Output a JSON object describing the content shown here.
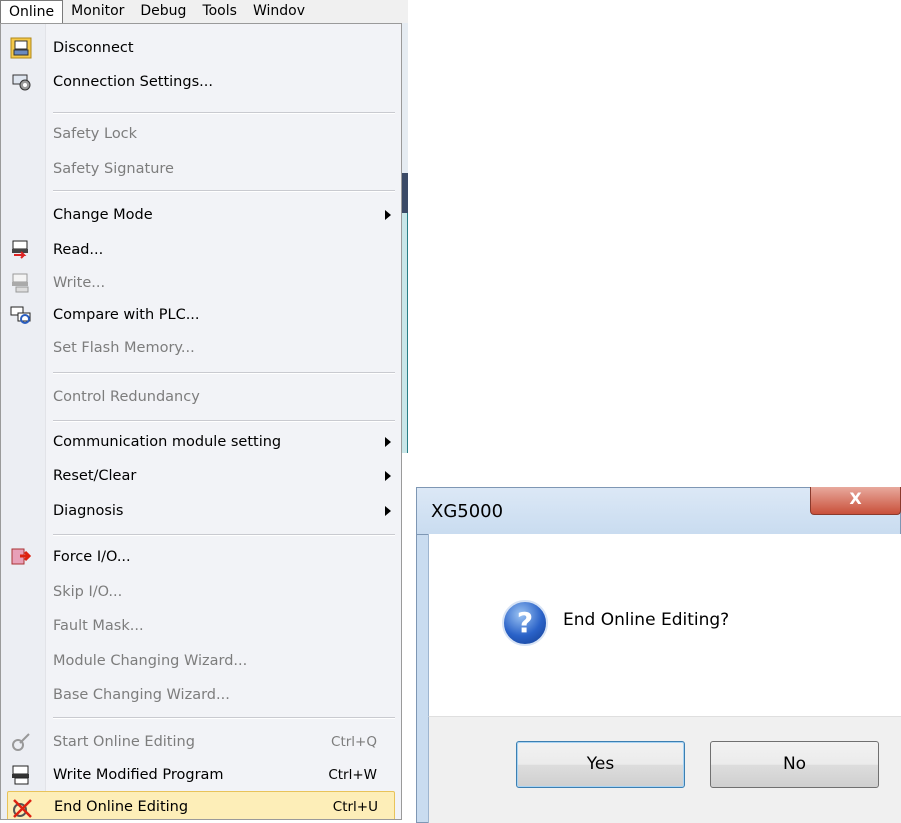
{
  "menubar": {
    "items": [
      "Online",
      "Monitor",
      "Debug",
      "Tools",
      "Windov"
    ]
  },
  "menu": {
    "items": [
      {
        "label": "Disconnect",
        "icon": "disconnect-icon",
        "enabled": true
      },
      {
        "label": "Connection Settings...",
        "icon": "connection-settings-icon",
        "enabled": true
      },
      {
        "label": "Safety Lock",
        "enabled": false
      },
      {
        "label": "Safety Signature",
        "enabled": false
      },
      {
        "label": "Change Mode",
        "enabled": true,
        "submenu": true
      },
      {
        "label": "Read...",
        "icon": "read-icon",
        "enabled": true
      },
      {
        "label": "Write...",
        "icon": "write-icon",
        "enabled": false
      },
      {
        "label": "Compare with PLC...",
        "icon": "compare-icon",
        "enabled": true
      },
      {
        "label": "Set Flash Memory...",
        "enabled": false
      },
      {
        "label": "Control Redundancy",
        "enabled": false
      },
      {
        "label": "Communication module setting",
        "enabled": true,
        "submenu": true
      },
      {
        "label": "Reset/Clear",
        "enabled": true,
        "submenu": true
      },
      {
        "label": "Diagnosis",
        "enabled": true,
        "submenu": true
      },
      {
        "label": "Force I/O...",
        "icon": "force-io-icon",
        "enabled": true
      },
      {
        "label": "Skip I/O...",
        "enabled": false
      },
      {
        "label": "Fault Mask...",
        "enabled": false
      },
      {
        "label": "Module Changing Wizard...",
        "enabled": false
      },
      {
        "label": "Base Changing Wizard...",
        "enabled": false
      },
      {
        "label": "Start Online Editing",
        "shortcut": "Ctrl+Q",
        "icon": "start-online-editing-icon",
        "enabled": false
      },
      {
        "label": "Write Modified Program",
        "shortcut": "Ctrl+W",
        "icon": "write-modified-program-icon",
        "enabled": true
      },
      {
        "label": "End Online Editing",
        "shortcut": "Ctrl+U",
        "icon": "end-online-editing-icon",
        "enabled": true,
        "selected": true
      }
    ]
  },
  "dialog": {
    "title": "XG5000",
    "close_label": "X",
    "icon": "question-icon",
    "icon_glyph": "?",
    "message": "End Online Editing?",
    "yes_label": "Yes",
    "no_label": "No"
  },
  "colors": {
    "menu_bg": "#f2f3f7",
    "selected_bg": "#fdeeb8",
    "disabled_text": "#7d7d7d",
    "dialog_frame": "#c9dcf0",
    "close_button": "#c9503a"
  }
}
